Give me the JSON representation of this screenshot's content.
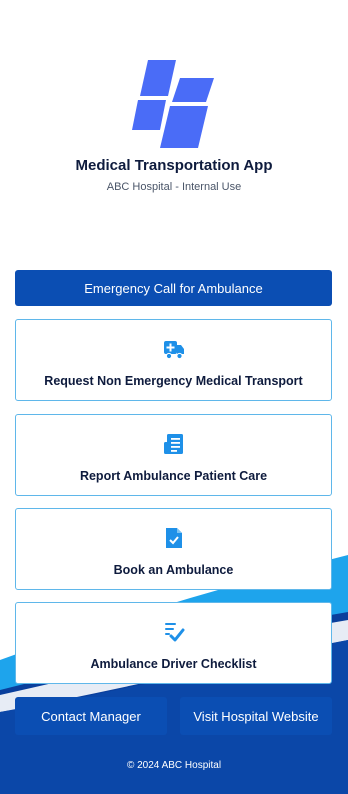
{
  "app": {
    "title": "Medical Transportation App",
    "subtitle": "ABC Hospital - Internal Use"
  },
  "primary_action": {
    "label": "Emergency Call for Ambulance"
  },
  "cards": [
    {
      "label": "Request Non Emergency Medical Transport",
      "icon": "ambulance-icon"
    },
    {
      "label": "Report Ambulance Patient Care",
      "icon": "document-list-icon"
    },
    {
      "label": "Book an Ambulance",
      "icon": "document-check-icon"
    },
    {
      "label": "Ambulance Driver Checklist",
      "icon": "checklist-icon"
    }
  ],
  "footer": {
    "contact_label": "Contact Manager",
    "website_label": "Visit Hospital Website",
    "copyright": "© 2024 ABC Hospital"
  },
  "colors": {
    "primary": "#0b4eb3",
    "accent": "#4a6cf7",
    "card_border": "#5fb7ea",
    "icon_blue": "#1e90e8",
    "footer_dark": "#0a3f9c",
    "wave_light": "#1ea4ec"
  }
}
